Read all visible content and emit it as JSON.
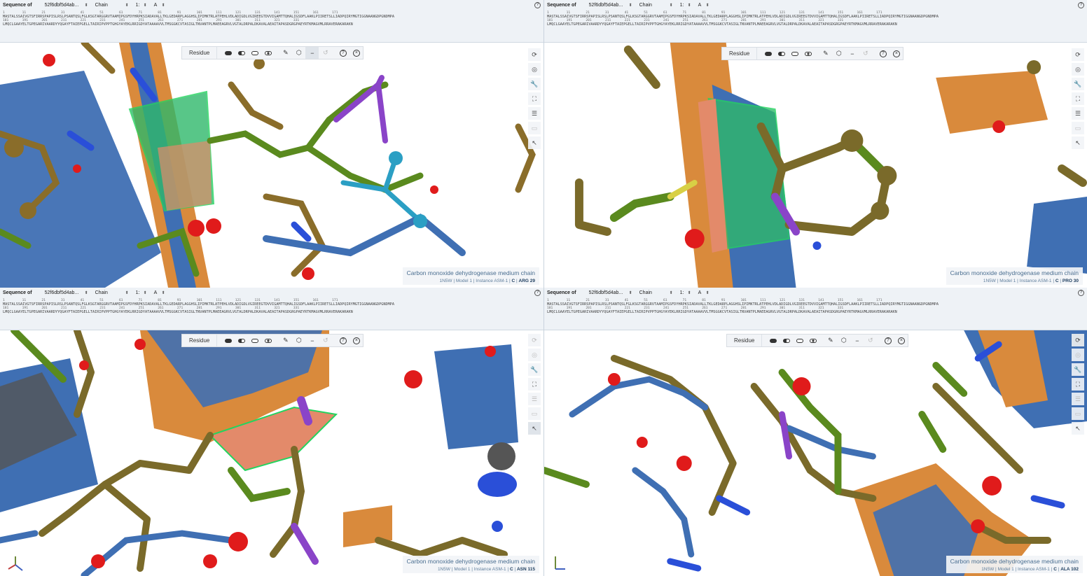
{
  "sequence_header": {
    "label": "Sequence of",
    "entity": "52f6dbf5d4ab...",
    "chain_label": "Chain",
    "model": "1:",
    "chain_id": "A"
  },
  "sequence_lines": {
    "ruler1": "1         11        21        31        41        51        61        71        81        91        101       111       121       131       141       151       161       171",
    "line1": "MASTALSSAIVGTSFIRRSPAPISLRSLPSANTQSLFGLKSGTARGGRVTAAMIPGSFDYHRPKSIADAVALLTKLGEDARPLAGGHSLIPIMKTRLATPEHLVDLADIGDLVGIREEGTDVVIGAMTTQHALIGSDFLAAKLPIIRETSLLIADPQIRYMGTIGGNAANGDPGNDMPA",
    "ruler2": "181       191       201       211       221       231       241       251       261       271       281       291       301       311       321       331",
    "line2": "LMQCLGAAYELTGPEGARIVAARDYYQGAYFTAIEPGELLTAIRIPVPPTGHGYAYEKLRRIGDYATAAAAVVLTMSGGKCVTASIGLTNVANTPLMAEEAGRVLVGTALDRPALDKAVALAEAITAPASDGRGPAEYRTKMAGVMLRRAVERAKARAKN"
  },
  "toolbar": {
    "mode_label": "Residue",
    "icons": [
      "ball-stick-full-icon",
      "ball-stick-half-icon",
      "outline-icon",
      "ring-icon",
      "brush-icon",
      "cube-icon",
      "minus-icon",
      "reset-icon",
      "help-icon",
      "close-icon"
    ]
  },
  "side_controls": [
    "refresh-icon",
    "target-icon",
    "wrench-icon",
    "expand-icon",
    "sliders-icon",
    "vr-icon",
    "cursor-icon"
  ],
  "panels": [
    {
      "highlight": "R",
      "info": {
        "name": "Carbon monoxide dehydrogenase medium chain",
        "pdb": "1N5W",
        "model": "Model 1",
        "instance": "Instance ASM-1",
        "chain": "C",
        "residue": "ARG 29"
      }
    },
    {
      "highlight": "P",
      "info": {
        "name": "Carbon monoxide dehydrogenase medium chain",
        "pdb": "1N5W",
        "model": "Model 1",
        "instance": "Instance ASM-1",
        "chain": "C",
        "residue": "PRO 30"
      }
    },
    {
      "highlight": "N",
      "info": {
        "name": "Carbon monoxide dehydrogenase medium chain",
        "pdb": "1N5W",
        "model": "Model 1",
        "instance": "Instance ASM-1",
        "chain": "C",
        "residue": "ASN 115"
      }
    },
    {
      "highlight": "A",
      "info": {
        "name": "Carbon monoxide dehydrogenase medium chain",
        "pdb": "1N5W",
        "model": "Model 1",
        "instance": "Instance ASM-1",
        "chain": "C",
        "residue": "ALA 102"
      }
    }
  ],
  "colors": {
    "helix_blue": "#3f6fb3",
    "sheet_orange": "#d98a3c",
    "carbon_olive": "#7a6a2a",
    "carbon_green": "#5a8a1e",
    "oxygen_red": "#e01b1b",
    "nitrogen_blue": "#2a4fd8",
    "selection_green": "#2fb86b",
    "sulfur_yellow": "#d8d045",
    "ligand_purple": "#8a44c8",
    "chlorine_teal": "#2b9fc4"
  }
}
